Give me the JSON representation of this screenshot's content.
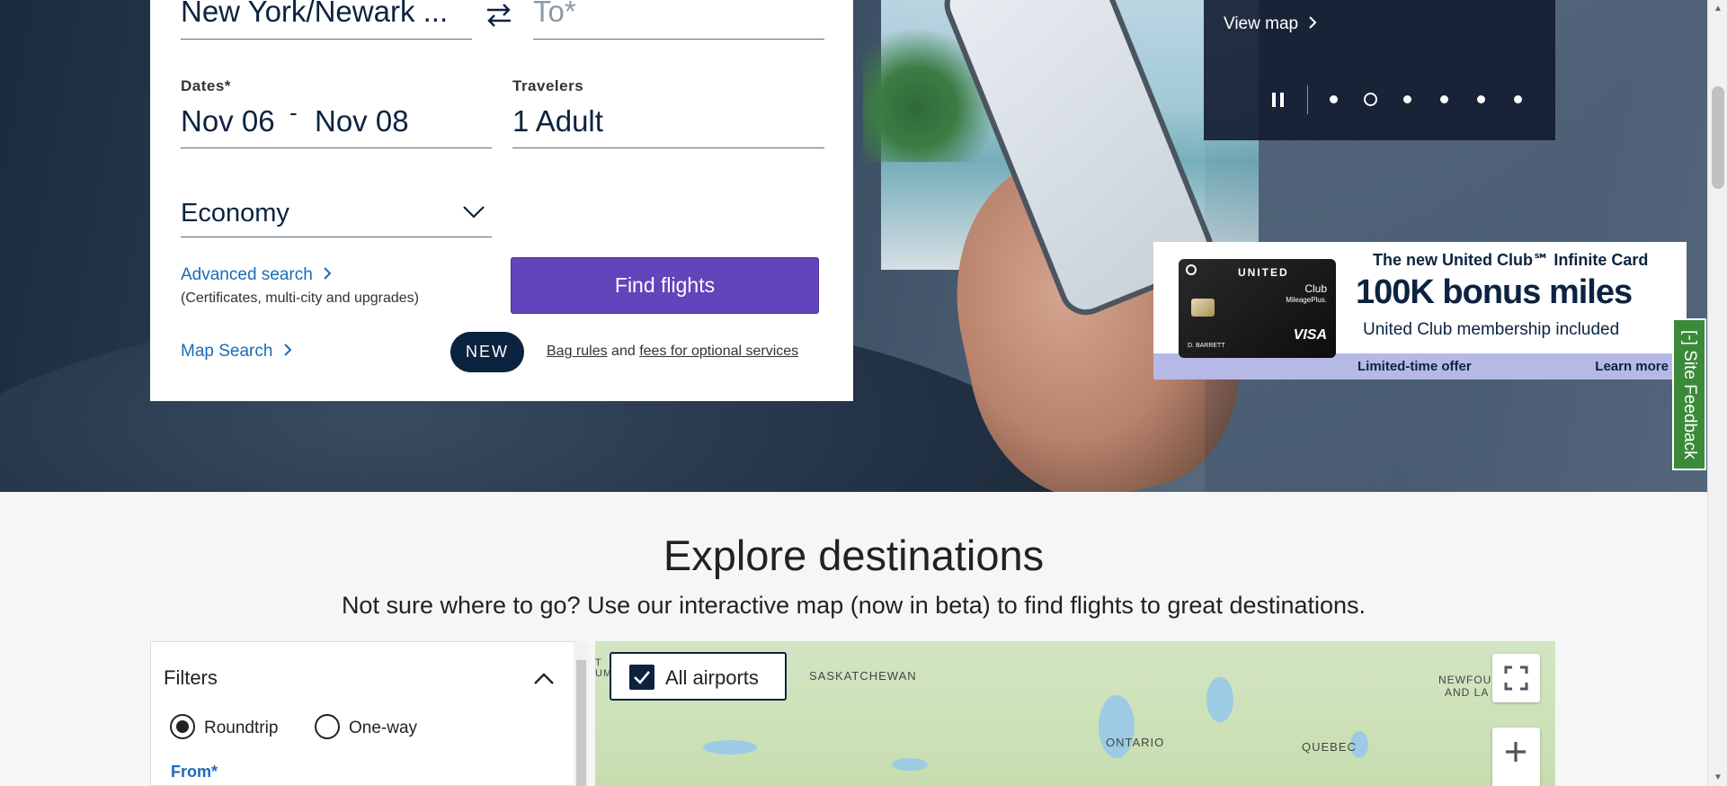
{
  "booking": {
    "from_value": "New York/Newark ...",
    "to_placeholder": "To*",
    "dates_label": "Dates*",
    "date_start": "Nov 06",
    "date_sep": "-",
    "date_end": "Nov 08",
    "travelers_label": "Travelers",
    "travelers_value": "1 Adult",
    "cabin_value": "Economy",
    "advanced_search": "Advanced search",
    "advanced_sub": "(Certificates, multi-city and upgrades)",
    "find_flights": "Find flights",
    "map_search": "Map Search",
    "new_badge": "NEW",
    "bag_rules": "Bag rules",
    "and_text": "and",
    "fees_link": "fees for optional services"
  },
  "carousel": {
    "view_map": "View map",
    "dots": 6,
    "active_index": 1
  },
  "ad": {
    "card_brand": "UNITED",
    "card_club": "Club",
    "card_mp": "MileagePlus.",
    "card_holder": "D. BARRETT",
    "card_visa": "VISA",
    "headline": "The new United Club℠ Infinite Card",
    "bonus": "100K bonus miles",
    "sub": "United Club membership included",
    "offer": "Limited-time offer",
    "learn_more": "Learn more"
  },
  "feedback": {
    "label": "[-] Site Feedback"
  },
  "explore": {
    "title": "Explore destinations",
    "subtitle": "Not sure where to go? Use our interactive map (now in beta) to find flights to great destinations."
  },
  "filters": {
    "title": "Filters",
    "roundtrip": "Roundtrip",
    "oneway": "One-way",
    "from_label": "From*"
  },
  "map": {
    "all_airports": "All airports",
    "labels": [
      "SASKATCHEWAN",
      "ONTARIO",
      "QUEBEC",
      "NEWFOUNDLAND",
      "AND LA"
    ],
    "edge_label": "T\nUM"
  },
  "colors": {
    "navy": "#0c2340",
    "purple_button": "#6244bb",
    "link_blue": "#1a6bb8",
    "feedback_green": "#3a8a3a"
  }
}
